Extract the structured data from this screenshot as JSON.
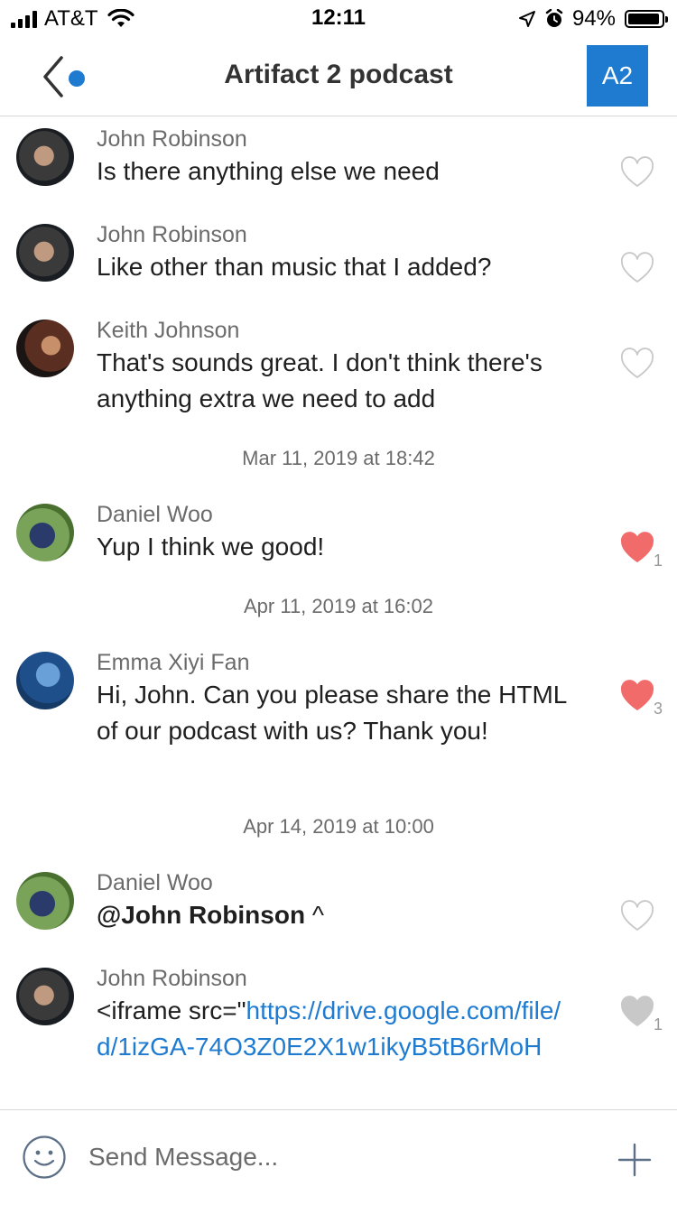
{
  "status_bar": {
    "carrier": "AT&T",
    "time": "12:11",
    "battery": "94%"
  },
  "header": {
    "title": "Artifact 2 podcast",
    "group_badge": "A2"
  },
  "messages": [
    {
      "sender": "John Robinson",
      "text": "Is there anything else we need",
      "liked": false,
      "likes": ""
    },
    {
      "sender": "John Robinson",
      "text": "Like other than music that I added?",
      "liked": false,
      "likes": ""
    },
    {
      "sender": "Keith Johnson",
      "text": "That's sounds great. I don't think there's anything extra we need to add",
      "liked": false,
      "likes": ""
    },
    {
      "sender": "Daniel Woo",
      "text": "Yup I think we good!",
      "liked": true,
      "likes": "1"
    },
    {
      "sender": "Emma Xiyi Fan",
      "text": "Hi, John. Can you please share the HTML of our podcast with us? Thank you!",
      "liked": true,
      "likes": "3"
    },
    {
      "sender": "Daniel Woo",
      "mention": "@John Robinson",
      "text": "^",
      "liked": false,
      "likes": ""
    },
    {
      "sender": "John Robinson",
      "text_prefix": "<iframe src=\"",
      "link": "https://drive.google.com/file/d/1izGA-74O3Z0E2X1w1ikyB5tB6rMoH",
      "liked": false,
      "likes": "1"
    }
  ],
  "timestamps": [
    "Mar 11, 2019 at 18:42",
    "Apr 11, 2019 at 16:02",
    "Apr 14, 2019 at 10:00"
  ],
  "composer": {
    "placeholder": "Send Message..."
  },
  "colors": {
    "accent": "#1e7bd0",
    "heart_liked": "#f26b6b",
    "heart_outline": "#c8c8c8",
    "heart_gray": "#c8c8c8"
  },
  "icons": [
    "back-chevron-icon",
    "heart-icon",
    "smiley-icon",
    "plus-icon"
  ]
}
